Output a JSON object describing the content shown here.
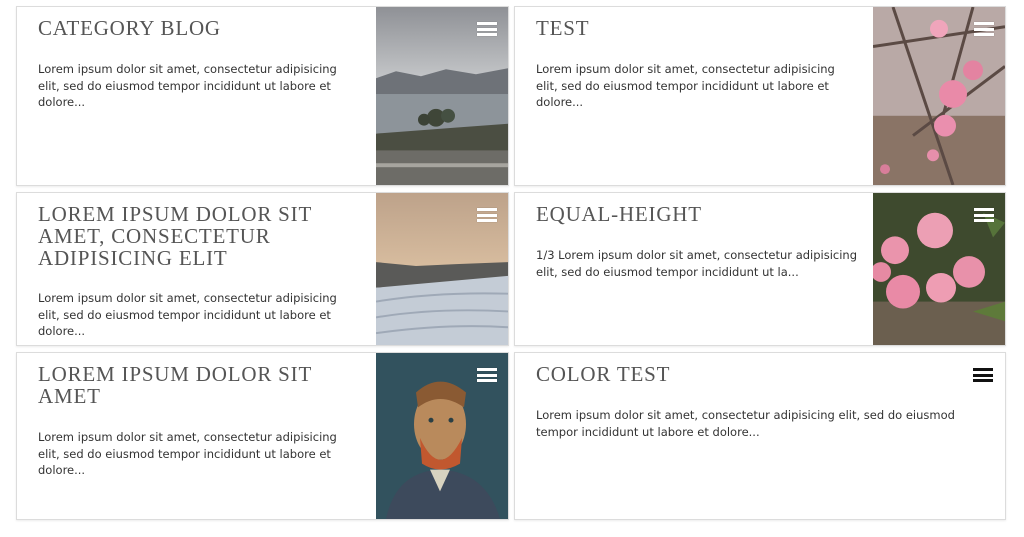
{
  "cards": [
    {
      "title": "CATEGORY BLOG",
      "excerpt": "Lorem ipsum dolor sit amet, consectetur adipisicing elit, sed do eiusmod tempor incididunt ut labore et dolore...",
      "image": "lake-landscape-photo"
    },
    {
      "title": "TEST",
      "excerpt": "Lorem ipsum dolor sit amet, consectetur adipisicing elit, sed do eiusmod tempor incididunt ut labore et dolore...",
      "image": "pink-blossom-photo"
    },
    {
      "title": "LOREM IPSUM DOLOR SIT AMET, CONSECTETUR ADIPISICING ELIT",
      "excerpt": "Lorem ipsum dolor sit amet, consectetur adipisicing elit, sed do eiusmod tempor incididunt ut labore et dolore...",
      "image": "snowy-field-sunset-photo"
    },
    {
      "title": "EQUAL-HEIGHT",
      "excerpt": "1/3 Lorem ipsum dolor sit amet, consectetur adipisicing elit, sed do eiusmod tempor incididunt ut la...",
      "image": "pink-roses-photo"
    },
    {
      "title": "LOREM IPSUM DOLOR SIT AMET",
      "excerpt": "Lorem ipsum dolor sit amet, consectetur adipisicing elit, sed do eiusmod tempor incididunt ut labore et dolore...",
      "image": "van-gogh-portrait"
    },
    {
      "title": "COLOR TEST",
      "excerpt": "Lorem ipsum dolor sit amet, consectetur adipisicing elit, sed do eiusmod tempor incididunt ut labore et dolore...",
      "image": ""
    }
  ],
  "icons": {
    "menu": "hamburger-menu-icon"
  },
  "colors": {
    "title": "#555555",
    "text": "#333333",
    "border": "#dcdcdc",
    "menu_light": "#ffffff",
    "menu_dark": "#111111"
  }
}
